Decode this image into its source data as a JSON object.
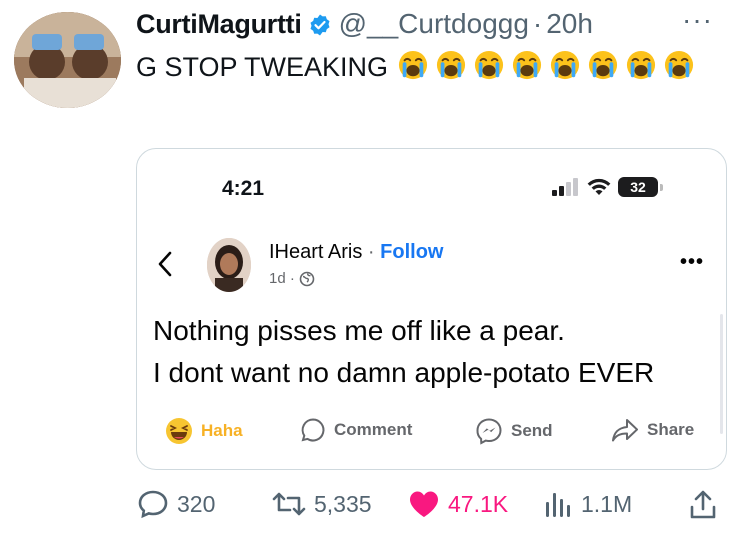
{
  "tweet": {
    "author_name": "CurtiMagurtti",
    "handle": "@__Curtdoggg",
    "separator": "·",
    "age": "20h",
    "more": "···",
    "text": "G STOP TWEAKING",
    "emoji_count": 8,
    "emoji_icon": "loudly-crying-face-icon"
  },
  "embed": {
    "status_time": "4:21",
    "battery": "32",
    "poster_name": "IHeart Aris",
    "follow_sep": " · ",
    "follow_label": "Follow",
    "post_meta": "1d ·",
    "more": "•••",
    "post_lines": [
      "Nothing pisses me off like a pear.",
      "I dont want no damn apple-potato EVER"
    ],
    "actions": {
      "haha": "Haha",
      "comment": "Comment",
      "send": "Send",
      "share": "Share"
    },
    "colors": {
      "link": "#1877f2",
      "haha": "#f7b125"
    }
  },
  "stats": {
    "replies": "320",
    "reposts": "5,335",
    "likes": "47.1K",
    "views": "1.1M"
  },
  "colors": {
    "verified": "#1d9bf0",
    "like": "#f91880",
    "muted": "#536471"
  }
}
